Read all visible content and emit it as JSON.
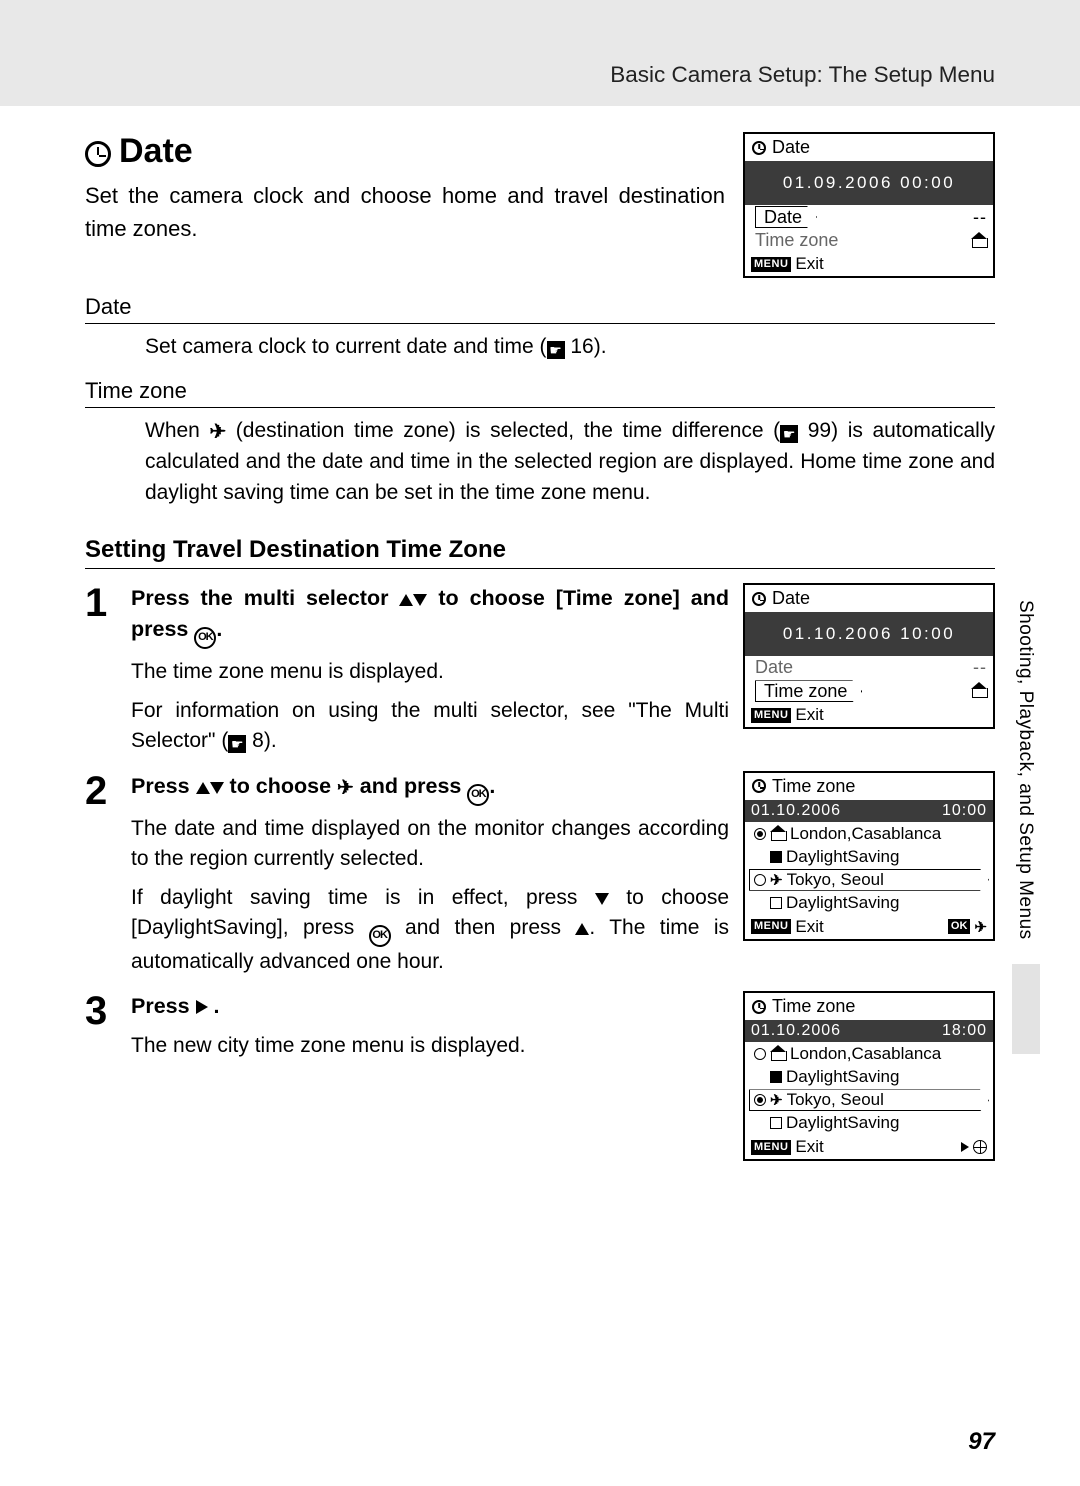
{
  "header": {
    "section_title": "Basic Camera Setup: The Setup Menu"
  },
  "title": "Date",
  "intro": "Set the camera clock and choose home and travel destination time zones.",
  "lcd_main": {
    "title": "Date",
    "datetime": "01.09.2006 00:00",
    "row1": "Date",
    "row1_val": "--",
    "row2": "Time zone",
    "exit": "Exit"
  },
  "def": {
    "date_term": "Date",
    "date_body_a": "Set camera clock to current date and time (",
    "date_body_b": " 16).",
    "tz_term": "Time zone",
    "tz_body_a": "When ",
    "tz_body_b": " (destination time zone) is selected, the time difference (",
    "tz_body_c": " 99) is automatically calculated and the date and time in the selected region are displayed. Home time zone and daylight saving time can be set in the time zone menu."
  },
  "sub_heading": "Setting Travel Destination Time Zone",
  "step1": {
    "bold_a": "Press the multi selector ",
    "bold_b": " to choose [Time zone] and press ",
    "bold_c": ".",
    "p1": "The time zone menu is displayed.",
    "p2_a": "For information on using the multi selector, see \"The Multi Selector\" (",
    "p2_b": " 8).",
    "lcd": {
      "title": "Date",
      "datetime": "01.10.2006 10:00",
      "row1": "Date",
      "row1_val": "--",
      "row2": "Time zone",
      "exit": "Exit"
    }
  },
  "step2": {
    "bold_a": "Press ",
    "bold_b": " to choose ",
    "bold_c": " and press ",
    "bold_d": ".",
    "p1": "The date and time displayed on the monitor changes according to the region currently selected.",
    "p2_a": "If daylight saving time is in effect, press ",
    "p2_b": " to choose [DaylightSaving], press ",
    "p2_c": " and then press ",
    "p2_d": ". The time is automatically advanced one hour.",
    "lcd": {
      "title": "Time zone",
      "date": "01.10.2006",
      "time": "10:00",
      "home": "London,Casablanca",
      "home_ds": "DaylightSaving",
      "dest": "Tokyo, Seoul",
      "dest_ds": "DaylightSaving",
      "exit": "Exit"
    }
  },
  "step3": {
    "bold_a": "Press ",
    "bold_b": ".",
    "p1": "The new city time zone menu is displayed.",
    "lcd": {
      "title": "Time zone",
      "date": "01.10.2006",
      "time": "18:00",
      "home": "London,Casablanca",
      "home_ds": "DaylightSaving",
      "dest": "Tokyo, Seoul",
      "dest_ds": "DaylightSaving",
      "exit": "Exit"
    }
  },
  "side_text": "Shooting, Playback, and Setup Menus",
  "page_number": "97",
  "labels": {
    "menu": "MENU",
    "ok": "OK"
  }
}
